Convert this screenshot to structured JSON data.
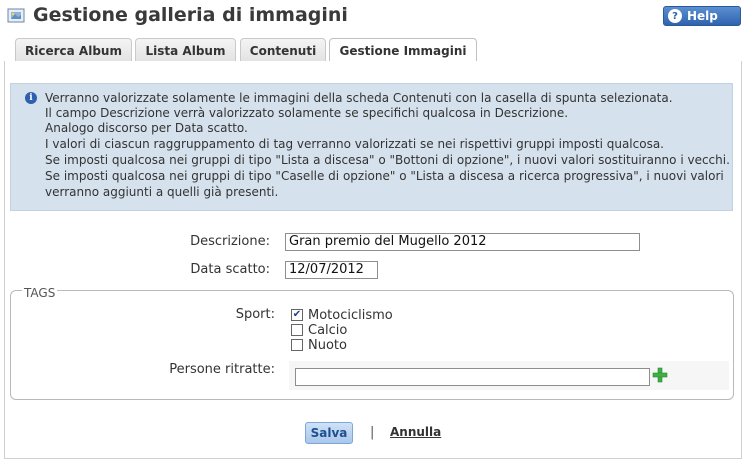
{
  "header": {
    "title": "Gestione galleria di immagini",
    "help_label": "Help"
  },
  "tabs": [
    {
      "label": "Ricerca Album",
      "active": false
    },
    {
      "label": "Lista Album",
      "active": false
    },
    {
      "label": "Contenuti",
      "active": false
    },
    {
      "label": "Gestione Immagini",
      "active": true
    }
  ],
  "info": {
    "lines": [
      "Verranno valorizzate solamente le immagini della scheda Contenuti con la casella di spunta selezionata.",
      "Il campo Descrizione verrà valorizzato solamente se specifichi qualcosa in Descrizione.",
      "Analogo discorso per Data scatto.",
      "I valori di ciascun raggruppamento di tag verranno valorizzati se nei rispettivi gruppi imposti qualcosa.",
      "Se imposti qualcosa nei gruppi di tipo \"Lista a discesa\" o \"Bottoni di opzione\", i nuovi valori sostituiranno i vecchi.",
      "Se imposti qualcosa nei gruppi di tipo \"Caselle di opzione\" o \"Lista a discesa a ricerca progressiva\", i nuovi valori",
      "verranno aggiunti a quelli già presenti."
    ]
  },
  "form": {
    "descrizione_label": "Descrizione:",
    "descrizione_value": "Gran premio del Mugello 2012",
    "data_label": "Data scatto:",
    "data_value": "12/07/2012"
  },
  "tags": {
    "legend": "TAGS",
    "sport_label": "Sport:",
    "sport_options": [
      {
        "label": "Motociclismo",
        "checked": true
      },
      {
        "label": "Calcio",
        "checked": false
      },
      {
        "label": "Nuoto",
        "checked": false
      }
    ],
    "persone_label": "Persone ritratte:",
    "persone_value": ""
  },
  "actions": {
    "save_label": "Salva",
    "separator": "|",
    "cancel_label": "Annulla"
  },
  "colors": {
    "info_bg": "#d5e1ec",
    "help_button": "#3d72bf",
    "save_button": "#b8d2ef",
    "add_icon": "#3cb043"
  }
}
